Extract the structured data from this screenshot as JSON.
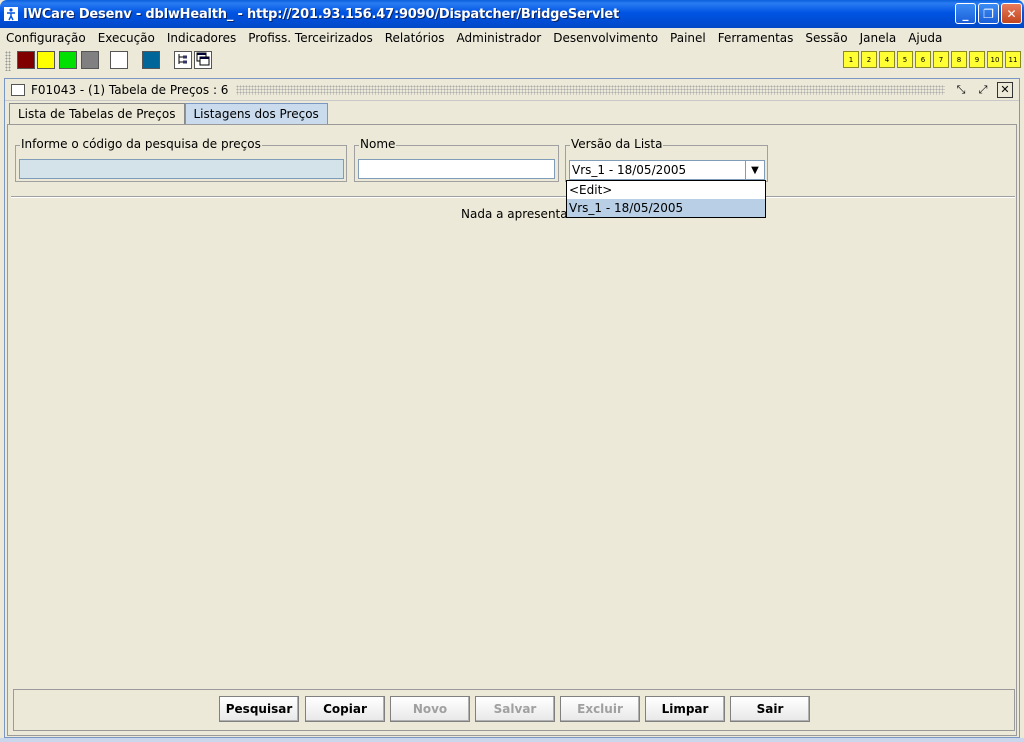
{
  "window": {
    "title": "IWCare Desenv - dblwHealth_ - http://201.93.156.47:9090/Dispatcher/BridgeServlet",
    "app_icon": "accessibility-icon",
    "minimize_icon": "minimize-icon",
    "maximize_icon": "restore-icon",
    "close_icon": "close-icon"
  },
  "menubar": {
    "items": [
      "Configuração",
      "Execução",
      "Indicadores",
      "Profiss. Terceirizados",
      "Relatórios",
      "Administrador",
      "Desenvolvimento",
      "Painel",
      "Ferramentas",
      "Sessão",
      "Janela",
      "Ajuda"
    ]
  },
  "toolbar": {
    "swatches": [
      "#800000",
      "#ffff00",
      "#00e000",
      "#808080",
      "#ffffff",
      "#006699"
    ],
    "number_buttons": [
      "1",
      "2",
      "4",
      "5",
      "6",
      "7",
      "8",
      "9",
      "10",
      "11"
    ],
    "number_button_color": "#ffff33"
  },
  "frame": {
    "title": "F01043 - (1) Tabela de Preços : 6",
    "tabs": [
      "Lista de Tabelas de Preços",
      "Listagens dos Preços"
    ],
    "active_tab": "Listagens dos Preços"
  },
  "form": {
    "codigo_label": "Informe o código da pesquisa de preços",
    "codigo_value": "",
    "nome_label": "Nome",
    "nome_value": "",
    "versao_label": "Versão da Lista",
    "versao_value": "Vrs_1 - 18/05/2005",
    "versao_options": [
      "<Edit>",
      "Vrs_1 - 18/05/2005"
    ]
  },
  "content": {
    "empty_message": "Nada a apresentar"
  },
  "buttons": {
    "pesquisar": "Pesquisar",
    "copiar": "Copiar",
    "novo": "Novo",
    "salvar": "Salvar",
    "excluir": "Excluir",
    "limpar": "Limpar",
    "sair": "Sair"
  },
  "colors": {
    "titlebar": "#0054e3",
    "active_tab": "#c9dbed",
    "dropdown_selection": "#b8cfe5",
    "disabled_field": "#d4e2ea"
  }
}
